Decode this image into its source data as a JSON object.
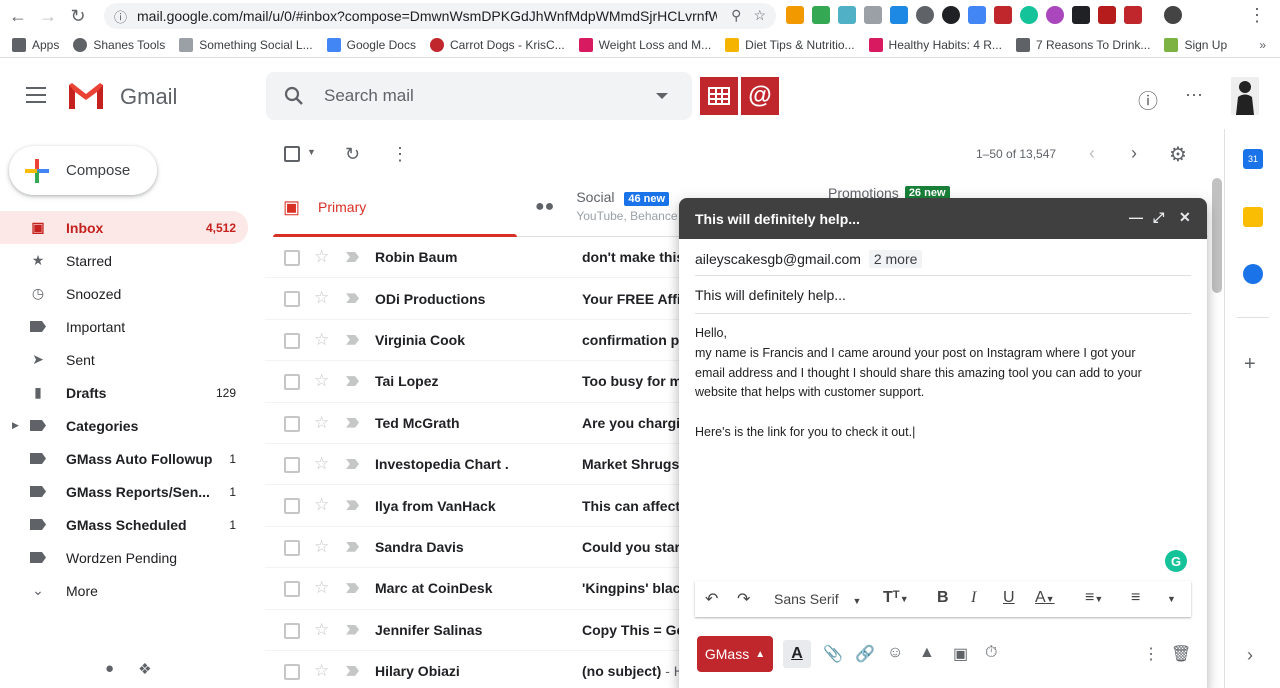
{
  "browser": {
    "url": "mail.google.com/mail/u/0/#inbox?compose=DmwnWsmDPKGdJhWnfMdpWMmdSjrHCLvrnfWdf...",
    "bookmarks": [
      {
        "label": "Apps",
        "color": "#5f6368"
      },
      {
        "label": "Shanes Tools",
        "color": "#5f6368"
      },
      {
        "label": "Something Social L...",
        "color": "#5f6368"
      },
      {
        "label": "Google Docs",
        "color": "#4285f4"
      },
      {
        "label": "Carrot Dogs - KrisC...",
        "color": "#c0272d"
      },
      {
        "label": "Weight Loss and M...",
        "color": "#d81b60"
      },
      {
        "label": "Diet Tips & Nutritio...",
        "color": "#f4b400"
      },
      {
        "label": "Healthy Habits: 4 R...",
        "color": "#d81b60"
      },
      {
        "label": "7 Reasons To Drink...",
        "color": "#5f6368"
      },
      {
        "label": "Sign Up",
        "color": "#7cb342"
      }
    ]
  },
  "header": {
    "app_name": "Gmail",
    "search_placeholder": "Search mail"
  },
  "sidebar": {
    "compose_label": "Compose",
    "items": [
      {
        "label": "Inbox",
        "count": "4,512",
        "icon": "inbox-icon",
        "active": true,
        "bold": true
      },
      {
        "label": "Starred",
        "count": "",
        "icon": "star-icon"
      },
      {
        "label": "Snoozed",
        "count": "",
        "icon": "clock-icon"
      },
      {
        "label": "Important",
        "count": "",
        "icon": "important-icon"
      },
      {
        "label": "Sent",
        "count": "",
        "icon": "send-icon"
      },
      {
        "label": "Drafts",
        "count": "129",
        "icon": "draft-icon",
        "bold": true
      },
      {
        "label": "Categories",
        "count": "",
        "icon": "label-icon",
        "bold": true,
        "caret": true
      },
      {
        "label": "GMass Auto Followup",
        "count": "1",
        "icon": "label-icon",
        "bold": true
      },
      {
        "label": "GMass Reports/Sen...",
        "count": "1",
        "icon": "label-icon",
        "bold": true
      },
      {
        "label": "GMass Scheduled",
        "count": "1",
        "icon": "label-icon",
        "bold": true
      },
      {
        "label": "Wordzen Pending",
        "count": "",
        "icon": "label-icon"
      },
      {
        "label": "More",
        "count": "",
        "icon": "chevron-down-icon"
      }
    ]
  },
  "toolbar": {
    "pager": "1–50 of 13,547"
  },
  "tabs": {
    "primary": "Primary",
    "social": "Social",
    "social_badge": "46 new",
    "social_sub": "YouTube, Behance",
    "promotions": "Promotions",
    "promotions_badge": "26 new"
  },
  "emails": [
    {
      "sender": "Robin Baum",
      "subject": "don't make this",
      "snippet": ""
    },
    {
      "sender": "ODi Productions",
      "subject": "Your FREE Affi",
      "snippet": ""
    },
    {
      "sender": "Virginia Cook",
      "subject": "confirmation p",
      "snippet": ""
    },
    {
      "sender": "Tai Lopez",
      "subject": "Too busy for m",
      "snippet": ""
    },
    {
      "sender": "Ted McGrath",
      "subject": "Are you chargi",
      "snippet": ""
    },
    {
      "sender": "Investopedia Chart .",
      "subject": "Market Shrugs",
      "snippet": ""
    },
    {
      "sender": "Ilya from VanHack",
      "subject": "This can affect",
      "snippet": ""
    },
    {
      "sender": "Sandra Davis",
      "subject": "Could you star",
      "snippet": ""
    },
    {
      "sender": "Marc at CoinDesk",
      "subject": "'Kingpins' blac",
      "snippet": ""
    },
    {
      "sender": "Jennifer Salinas",
      "subject": "Copy This = Ge",
      "snippet": ""
    },
    {
      "sender": "Hilary Obiazi",
      "subject": "(no subject)",
      "snippet": " - H"
    }
  ],
  "compose_window": {
    "title": "This will definitely help...",
    "recipient": "aileyscakesgb@gmail.com",
    "more_recipients": "2 more",
    "subject": "This will definitely help...",
    "body_lines": [
      "Hello,",
      "my name is Francis and I came around your post on Instagram where I got your",
      "email address and I thought I should share this amazing tool you can add to your",
      "website that helps with customer support.",
      "",
      "Here's is the link for you to check it out.|"
    ],
    "font_label": "Sans Serif",
    "gmass_label": "GMass"
  },
  "colors": {
    "gmail_red": "#c0272d",
    "inbox_active_bg": "#fce8e6",
    "social_badge": "#1a73e8",
    "promo_badge": "#188038"
  }
}
